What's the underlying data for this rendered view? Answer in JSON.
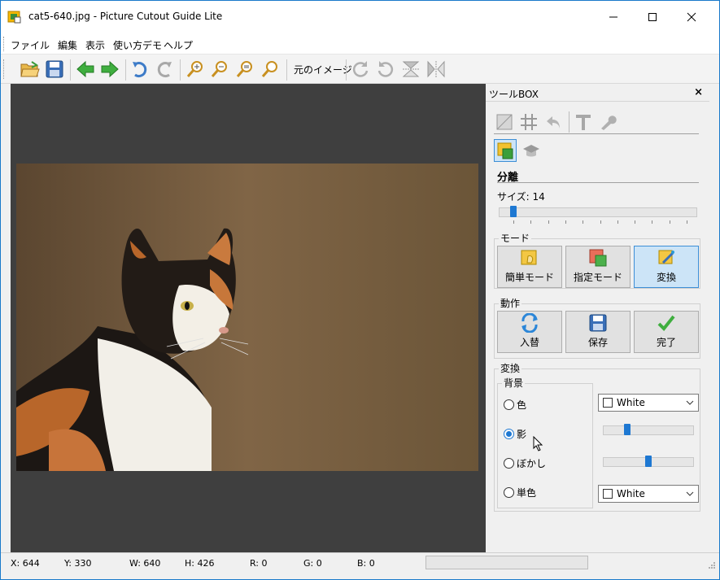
{
  "window": {
    "title": "cat5-640.jpg - Picture Cutout Guide Lite",
    "accent": "#1979ca"
  },
  "menu": {
    "items": [
      "ファイル",
      "編集",
      "表示",
      "使い方デモ",
      "ヘルプ"
    ]
  },
  "toolbar": {
    "icons": [
      "open-folder-icon",
      "save-icon",
      "back-arrow-icon",
      "forward-arrow-icon",
      "undo-icon",
      "redo-icon",
      "zoom-in-icon",
      "zoom-out-icon",
      "zoom-fit-icon",
      "zoom-actual-icon",
      "rotate-right-icon",
      "rotate-left-icon",
      "flip-vertical-icon",
      "flip-horizontal-icon"
    ],
    "original_image_label": "元のイメージ"
  },
  "toolbox": {
    "title": "ツールBOX",
    "close": "×",
    "section_title": "分離",
    "size_label": "サイズ: 14",
    "size_value": 14,
    "mode": {
      "title": "モード",
      "buttons": [
        {
          "label": "簡単モード",
          "active": false
        },
        {
          "label": "指定モード",
          "active": false
        },
        {
          "label": "変換",
          "active": true
        }
      ]
    },
    "action": {
      "title": "動作",
      "buttons": [
        {
          "label": "入替"
        },
        {
          "label": "保存"
        },
        {
          "label": "完了"
        }
      ]
    },
    "convert": {
      "title": "変換",
      "background_title": "背景",
      "options": [
        {
          "label": "色",
          "checked": false
        },
        {
          "label": "影",
          "checked": true
        },
        {
          "label": "ぼかし",
          "checked": false
        },
        {
          "label": "単色",
          "checked": false
        }
      ],
      "color_combo_1": "White",
      "color_combo_2": "White"
    }
  },
  "status": {
    "x": "X: 644",
    "y": "Y: 330",
    "w": "W: 640",
    "h": "H: 426",
    "r": "R: 0",
    "g": "G: 0",
    "b": "B: 0"
  }
}
